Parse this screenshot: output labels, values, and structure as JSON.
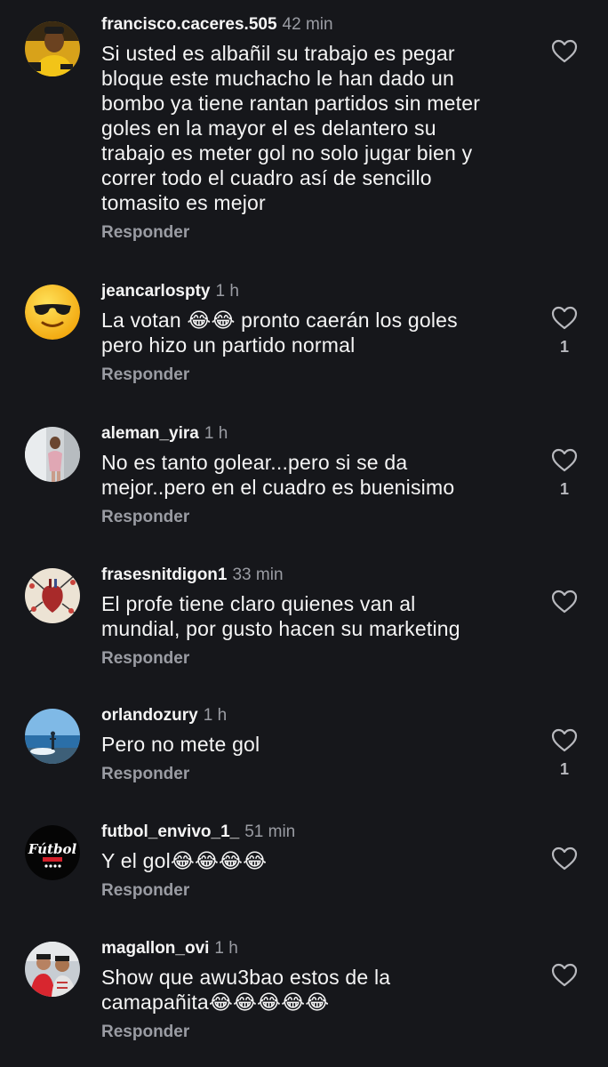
{
  "colors": {
    "background": "#16171b",
    "text": "#f5f5f5",
    "muted": "#9a9ca3"
  },
  "comments": [
    {
      "username": "francisco.caceres.505",
      "time": "42 min",
      "text": "Si usted es albañil su trabajo es pegar\nbloque este muchacho le han dado un\nbombo ya tiene rantan partidos sin meter\ngoles en la mayor el es delantero su\ntrabajo es meter gol no solo jugar bien y\ncorrer todo el cuadro así de sencillo\ntomasito es mejor",
      "reply_label": "Responder",
      "like_count": "",
      "avatar_icon": "person-yellow-shirt-avatar"
    },
    {
      "username": "jeancarlospty",
      "time": "1 h",
      "text": "La votan 😂😂 pronto caerán los goles\npero hizo un partido normal",
      "reply_label": "Responder",
      "like_count": "1",
      "avatar_icon": "sunglasses-emoji-avatar"
    },
    {
      "username": "aleman_yira",
      "time": "1 h",
      "text": "No es tanto golear...pero si se da\nmejor..pero en el cuadro es buenisimo",
      "reply_label": "Responder",
      "like_count": "1",
      "avatar_icon": "person-photo-avatar"
    },
    {
      "username": "frasesnitdigon1",
      "time": "33 min",
      "text": "El profe tiene claro quienes van al\nmundial, por gusto hacen su marketing",
      "reply_label": "Responder",
      "like_count": "",
      "avatar_icon": "anatomical-heart-avatar"
    },
    {
      "username": "orlandozury",
      "time": "1 h",
      "text": "Pero no mete gol",
      "reply_label": "Responder",
      "like_count": "1",
      "avatar_icon": "sea-landscape-avatar"
    },
    {
      "username": "futbol_envivo_1_",
      "time": "51 min",
      "text": "Y el gol😂😂😂😂",
      "reply_label": "Responder",
      "like_count": "",
      "avatar_icon": "futbol-logo-avatar",
      "avatar_logo_text": "Fútbol"
    },
    {
      "username": "magallon_ovi",
      "time": "1 h",
      "text": "Show que awu3bao  estos de la\ncamapañita😂😂😂😂😂",
      "reply_label": "Responder",
      "like_count": "",
      "avatar_icon": "two-people-avatar"
    }
  ]
}
